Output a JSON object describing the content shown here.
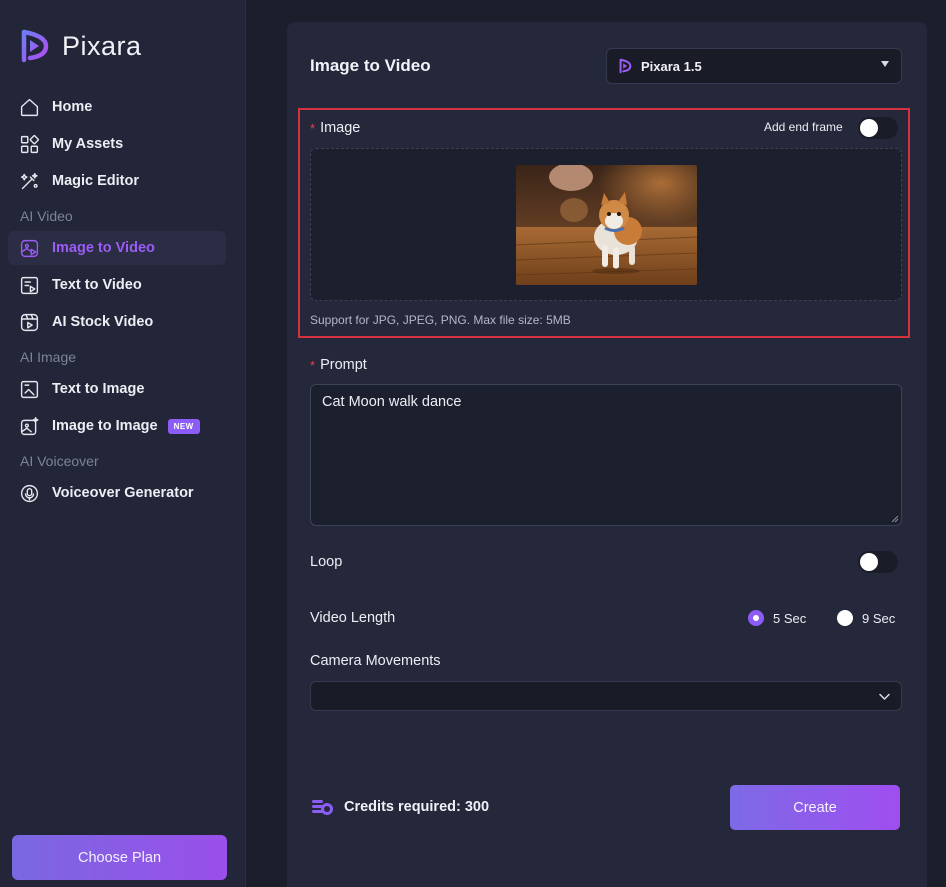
{
  "app": {
    "name": "Pixara"
  },
  "sidebar": {
    "items": [
      {
        "label": "Home",
        "icon": "home-icon"
      },
      {
        "label": "My Assets",
        "icon": "grid-icon"
      },
      {
        "label": "Magic Editor",
        "icon": "magic-wand-icon"
      }
    ],
    "sections": [
      {
        "title": "AI Video",
        "items": [
          {
            "label": "Image to Video",
            "icon": "image-video-icon",
            "active": true
          },
          {
            "label": "Text to Video",
            "icon": "text-video-icon"
          },
          {
            "label": "AI Stock Video",
            "icon": "stock-video-icon"
          }
        ]
      },
      {
        "title": "AI Image",
        "items": [
          {
            "label": "Text to Image",
            "icon": "text-image-icon"
          },
          {
            "label": "Image to Image",
            "icon": "image-image-icon",
            "badge": "NEW"
          }
        ]
      },
      {
        "title": "AI Voiceover",
        "items": [
          {
            "label": "Voiceover Generator",
            "icon": "voiceover-icon"
          }
        ]
      }
    ],
    "choose_plan": "Choose Plan"
  },
  "main": {
    "title": "Image to Video",
    "model": {
      "selected": "Pixara 1.5"
    },
    "image_field": {
      "required_mark": "*",
      "label": "Image",
      "end_frame_label": "Add end frame",
      "end_frame_on": false,
      "support_text": "Support for JPG, JPEG, PNG. Max file size: 5MB"
    },
    "prompt_field": {
      "required_mark": "*",
      "label": "Prompt",
      "value": "Cat Moon walk dance"
    },
    "loop": {
      "label": "Loop",
      "on": false
    },
    "video_length": {
      "label": "Video Length",
      "options": [
        "5 Sec",
        "9 Sec"
      ],
      "selected": "5 Sec"
    },
    "camera_movements": {
      "label": "Camera Movements",
      "value": ""
    },
    "credits": {
      "text": "Credits required: 300"
    },
    "create_label": "Create"
  },
  "colors": {
    "accent": "#8b5cf6",
    "highlight_border": "#d6323d",
    "sidebar_bg": "#222638",
    "panel_bg": "#24283a"
  }
}
